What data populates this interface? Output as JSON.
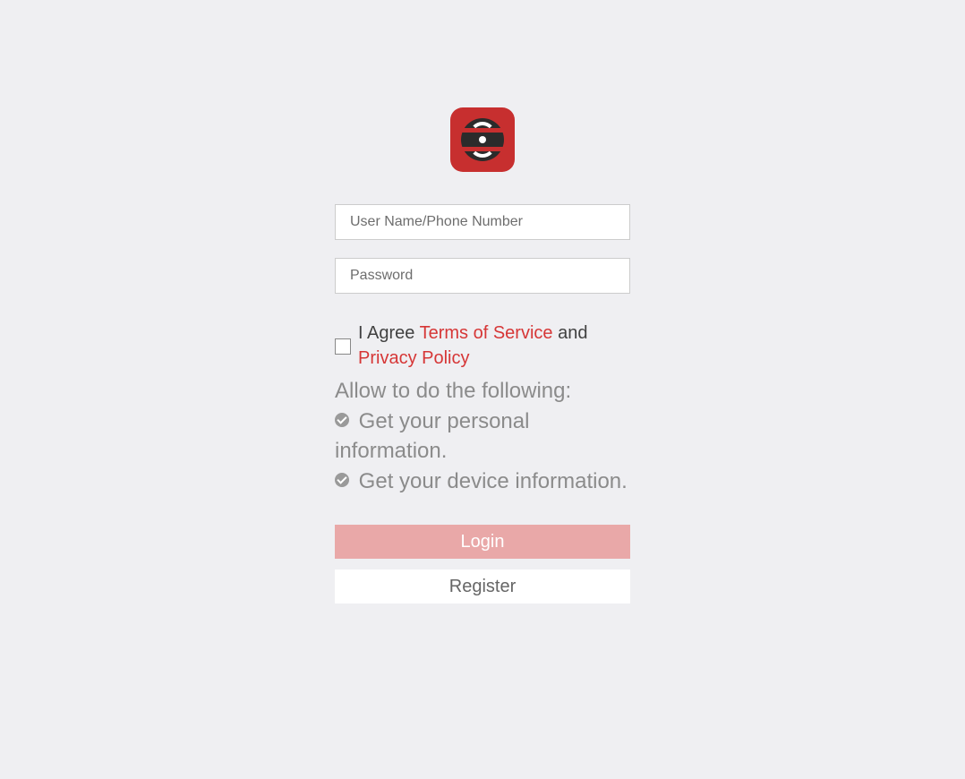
{
  "form": {
    "username_placeholder": "User Name/Phone Number",
    "username_value": "",
    "password_placeholder": "Password",
    "password_value": ""
  },
  "agreement": {
    "prefix": "I Agree ",
    "terms_label": "Terms of Service",
    "middle": " and ",
    "privacy_label": "Privacy Policy"
  },
  "permissions": {
    "heading": "Allow to do the following:",
    "items": [
      "Get your personal information.",
      "Get your device information."
    ]
  },
  "buttons": {
    "login_label": "Login",
    "register_label": "Register"
  }
}
